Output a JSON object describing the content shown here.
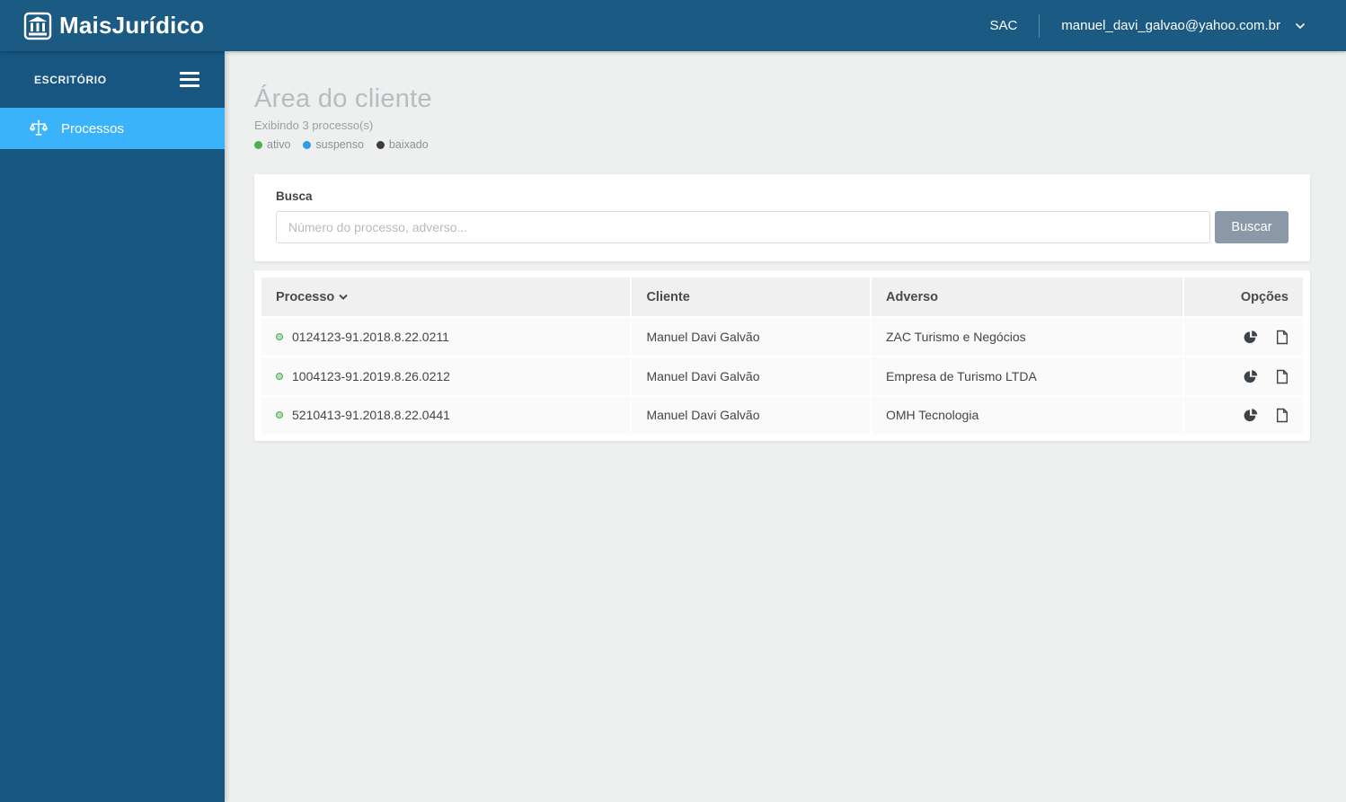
{
  "topbar": {
    "brand": "MaisJurídico",
    "sac_label": "SAC",
    "user_email": "manuel_davi_galvao@yahoo.com.br"
  },
  "sidebar": {
    "section_label": "ESCRITÓRIO",
    "items": [
      {
        "label": "Processos",
        "icon": "scales-icon",
        "active": true
      }
    ]
  },
  "main": {
    "title": "Área do cliente",
    "subtitle": "Exibindo 3 processo(s)",
    "legend": [
      {
        "label": "ativo",
        "color": "#4caf50"
      },
      {
        "label": "suspenso",
        "color": "#2f9ce8"
      },
      {
        "label": "baixado",
        "color": "#3d3d3d"
      }
    ],
    "status_colors": {
      "ativo": "#4caf50",
      "suspenso": "#2f9ce8",
      "baixado": "#3d3d3d"
    },
    "search": {
      "label": "Busca",
      "placeholder": "Número do processo, adverso...",
      "button_label": "Buscar"
    },
    "table": {
      "columns": [
        "Processo",
        "Cliente",
        "Adverso",
        "Opções"
      ],
      "row_icons": [
        "pie-chart",
        "document"
      ],
      "rows": [
        {
          "status": "ativo",
          "processo": "0124123-91.2018.8.22.0211",
          "cliente": "Manuel Davi Galvão",
          "adverso": "ZAC Turismo e Negócios"
        },
        {
          "status": "ativo",
          "processo": "1004123-91.2019.8.26.0212",
          "cliente": "Manuel Davi Galvão",
          "adverso": "Empresa de Turismo LTDA"
        },
        {
          "status": "ativo",
          "processo": "5210413-91.2018.8.22.0441",
          "cliente": "Manuel Davi Galvão",
          "adverso": "OMH Tecnologia"
        }
      ]
    }
  },
  "colors": {
    "topbar_bg": "#1b5a83",
    "sidebar_bg": "#175680",
    "sidebar_active": "#3ab3fa",
    "button_bg": "#8a98a8"
  }
}
